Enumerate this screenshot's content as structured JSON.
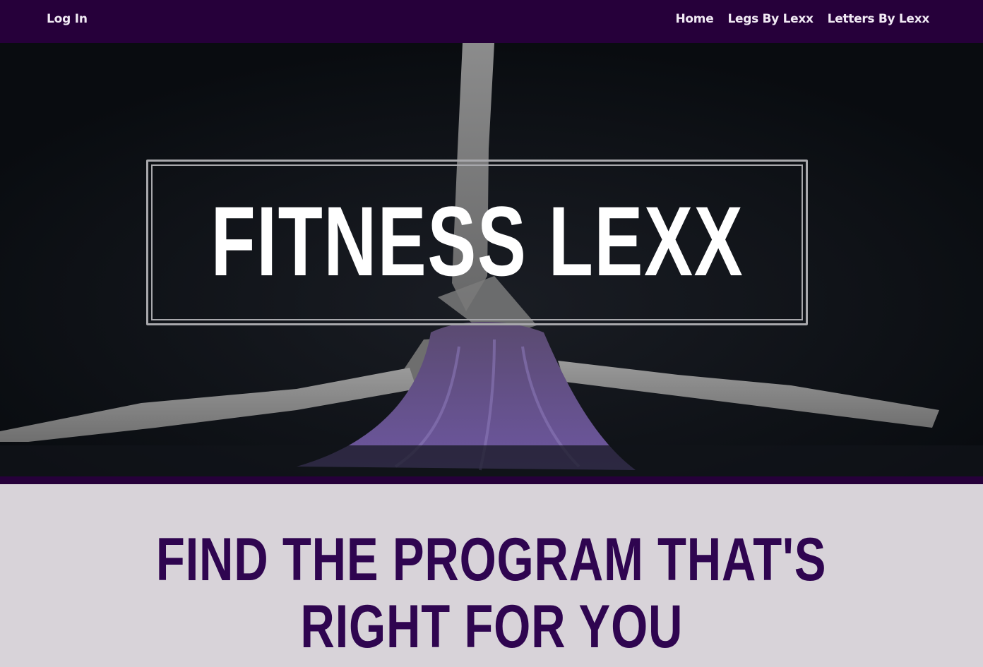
{
  "header": {
    "login_label": "Log In",
    "nav": [
      {
        "label": "Home"
      },
      {
        "label": "Legs By Lexx"
      },
      {
        "label": "Letters By Lexx"
      }
    ]
  },
  "hero": {
    "title": "FITNESS LEXX"
  },
  "section": {
    "headline_line1": "FIND THE PROGRAM THAT'S",
    "headline_line2": "RIGHT FOR YOU"
  },
  "colors": {
    "header_bg": "#26003a",
    "hero_bg": "#0a0d12",
    "section_bg": "#d8d3d9",
    "headline": "#2f0550"
  }
}
